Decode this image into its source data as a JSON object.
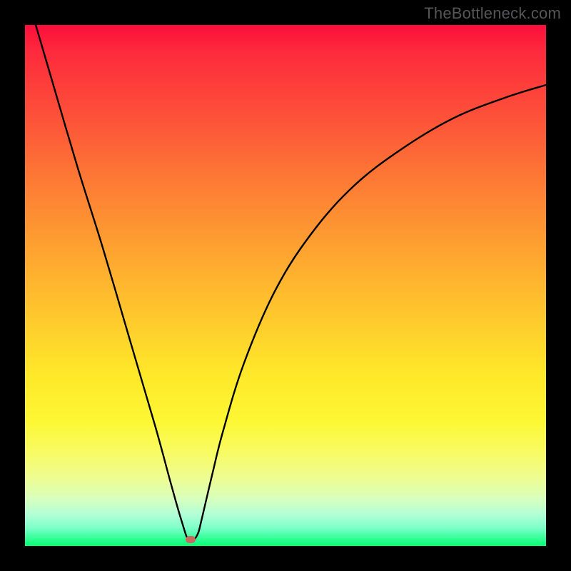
{
  "watermark": "TheBottleneck.com",
  "chart_data": {
    "type": "line",
    "title": "",
    "xlabel": "",
    "ylabel": "",
    "x_range": [
      0,
      100
    ],
    "y_range": [
      0,
      100
    ],
    "grid": false,
    "series": [
      {
        "name": "bottleneck-curve",
        "x": [
          0,
          5,
          10,
          15,
          20,
          25,
          28,
          30,
          31.5,
          33,
          34,
          36,
          38,
          42,
          48,
          55,
          63,
          72,
          82,
          92,
          100
        ],
        "y": [
          107,
          90,
          73,
          57,
          40,
          23,
          12,
          5,
          1.0,
          2,
          5.5,
          14,
          22,
          35,
          49,
          60,
          69,
          76,
          82,
          86,
          88.5
        ]
      }
    ],
    "marker": {
      "x": 31.8,
      "y": 1.2
    },
    "colors": {
      "gradient_top": "#fd0d3c",
      "gradient_bottom": "#06ff72",
      "curve": "#000000",
      "marker": "#c66b60",
      "frame": "#000000"
    }
  }
}
